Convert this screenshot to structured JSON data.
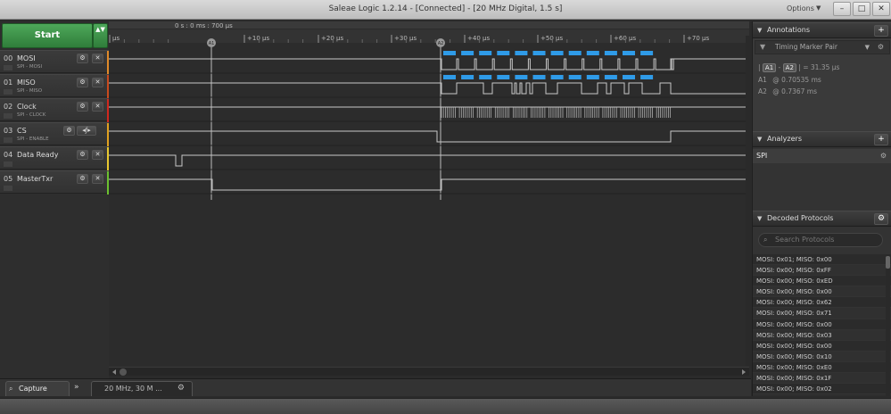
{
  "window": {
    "title": "Saleae Logic 1.2.14 - [Connected] - [20 MHz Digital, 1.5 s]",
    "options_label": "Options",
    "controls": {
      "minimize": "–",
      "maximize": "□",
      "close": "✕"
    }
  },
  "start_button": {
    "label": "Start",
    "arrows": "▲▼"
  },
  "channels": [
    {
      "num": "00",
      "name": "MOSI",
      "sub": "SPI - MOSI",
      "color": "#e08a2a"
    },
    {
      "num": "01",
      "name": "MISO",
      "sub": "SPI - MISO",
      "color": "#c84a1e"
    },
    {
      "num": "02",
      "name": "Clock",
      "sub": "SPI - CLOCK",
      "color": "#d0281e"
    },
    {
      "num": "03",
      "name": "CS",
      "sub": "SPI - ENABLE",
      "color": "#e0a020"
    },
    {
      "num": "04",
      "name": "Data Ready",
      "sub": "",
      "color": "#e8c830"
    },
    {
      "num": "05",
      "name": "MasterTxr",
      "sub": "",
      "color": "#6cc030"
    }
  ],
  "timeline": {
    "origin_label": "0 s : 0 ms : 700 µs",
    "ticks": [
      "µs",
      "+10 µs",
      "+20 µs",
      "+30 µs",
      "+40 µs",
      "+50 µs",
      "+60 µs",
      "+70 µs"
    ],
    "marker_a1": "A1",
    "marker_a2": "A2"
  },
  "bottom": {
    "capture_tab": "Capture",
    "more": "»",
    "session_tab": "20 MHz, 30 M ..."
  },
  "annotations": {
    "header": "Annotations",
    "marker_pair": "Timing Marker Pair",
    "delta_a1": "A1",
    "delta_a2": "A2",
    "delta_value": "= 31.35 µs",
    "a1_label": "A1",
    "a1_value": "@  0.70535 ms",
    "a2_label": "A2",
    "a2_value": "@  0.7367 ms"
  },
  "analyzers": {
    "header": "Analyzers",
    "items": [
      "SPI"
    ]
  },
  "decoded": {
    "header": "Decoded Protocols",
    "search_placeholder": "Search Protocols",
    "rows": [
      "MOSI: 0x01;  MISO: 0x00",
      "MOSI: 0x00;  MISO: 0xFF",
      "MOSI: 0x00;  MISO: 0xED",
      "MOSI: 0x00;  MISO: 0x00",
      "MOSI: 0x00;  MISO: 0x62",
      "MOSI: 0x00;  MISO: 0x71",
      "MOSI: 0x00;  MISO: 0x00",
      "MOSI: 0x00;  MISO: 0x03",
      "MOSI: 0x00;  MISO: 0x00",
      "MOSI: 0x00;  MISO: 0x10",
      "MOSI: 0x00;  MISO: 0xE0",
      "MOSI: 0x00;  MISO: 0x1F",
      "MOSI: 0x00;  MISO: 0x02"
    ]
  }
}
